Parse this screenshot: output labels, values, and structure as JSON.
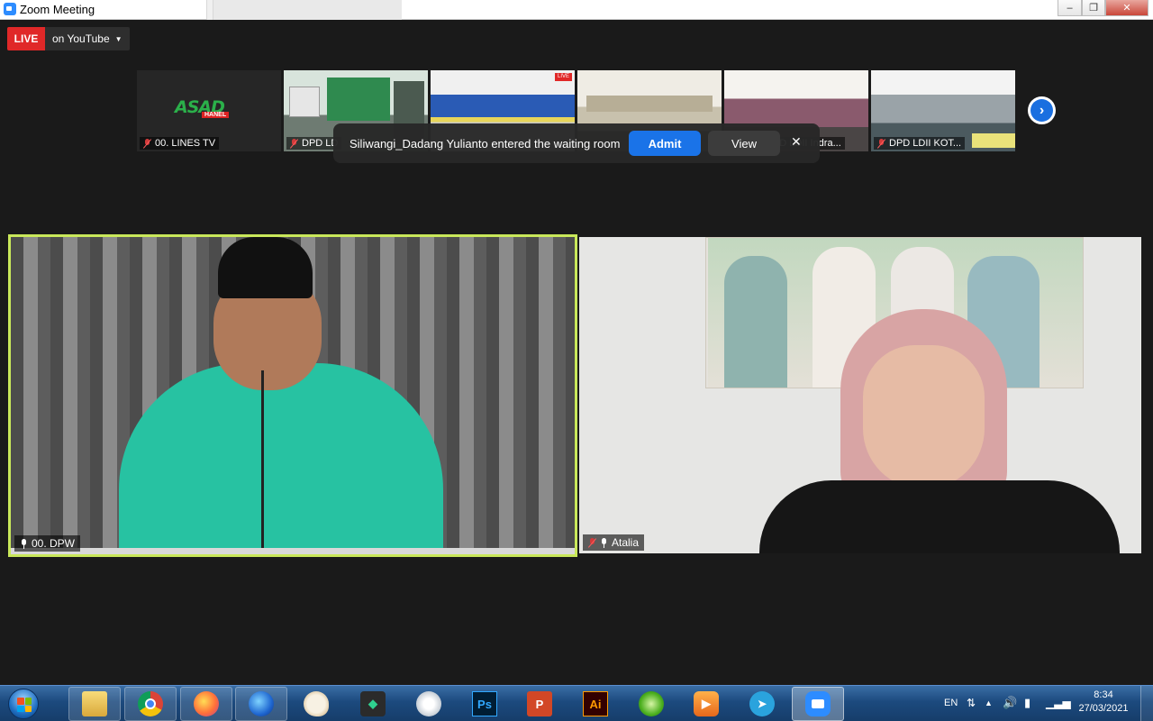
{
  "window": {
    "title": "Zoom Meeting",
    "min": "‒",
    "max": "❐",
    "close": "✕"
  },
  "live": {
    "badge": "LIVE",
    "destination": "on YouTube"
  },
  "thumbnails": [
    {
      "name": "00. LINES TV",
      "logo_text": "ASAD",
      "logo_sub": "HANEL"
    },
    {
      "name": "DPD LD"
    },
    {
      "name": ""
    },
    {
      "name": ""
    },
    {
      "name": "DPD LDII Indra..."
    },
    {
      "name": "DPD LDII KOT..."
    }
  ],
  "notification": {
    "message": "Siliwangi_Dadang Yulianto entered the waiting room",
    "admit_label": "Admit",
    "view_label": "View",
    "close": "✕"
  },
  "videos": {
    "left": {
      "name": "00. DPW"
    },
    "right": {
      "name": "Atalia"
    }
  },
  "taskbar": {
    "apps": [
      "explorer",
      "chrome",
      "firefox",
      "firefox-dev",
      "paint",
      "filmora",
      "scanner",
      "photoshop",
      "powerpoint",
      "illustrator",
      "app-green",
      "media-player",
      "telegram",
      "zoom"
    ],
    "ps_label": "Ps",
    "ai_label": "Ai",
    "ppt_label": "P",
    "language": "EN",
    "time": "8:34",
    "date": "27/03/2021"
  },
  "colors": {
    "live": "#e02828",
    "admit": "#1a73e8",
    "active_speaker": "#c9e85a"
  }
}
